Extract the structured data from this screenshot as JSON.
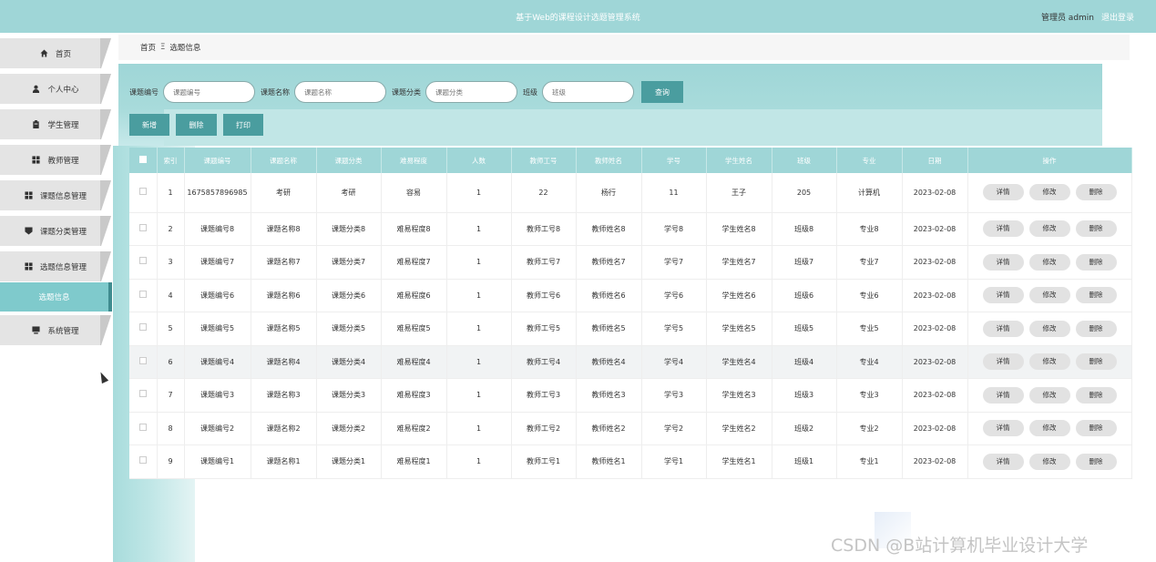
{
  "header": {
    "title": "基于Web的课程设计选题管理系统",
    "admin": "管理员 admin",
    "logout": "退出登录"
  },
  "sidebar": {
    "items": [
      {
        "label": "首页",
        "icon": "home-icon"
      },
      {
        "label": "个人中心",
        "icon": "user-icon"
      },
      {
        "label": "学生管理",
        "icon": "clipboard-icon"
      },
      {
        "label": "教师管理",
        "icon": "grid-icon"
      },
      {
        "label": "课题信息管理",
        "icon": "grid-icon"
      },
      {
        "label": "课题分类管理",
        "icon": "tag-icon"
      },
      {
        "label": "选题信息管理",
        "icon": "grid-icon"
      },
      {
        "label": "系统管理",
        "icon": "monitor-icon"
      }
    ],
    "active_sub": "选题信息"
  },
  "breadcrumb": {
    "home": "首页",
    "sep": "Ξ",
    "current": "选题信息"
  },
  "search": {
    "fields": [
      {
        "label": "课题编号",
        "placeholder": "课题编号"
      },
      {
        "label": "课题名称",
        "placeholder": "课题名称"
      },
      {
        "label": "课题分类",
        "placeholder": "课题分类"
      },
      {
        "label": "班级",
        "placeholder": "班级"
      }
    ],
    "query_btn": "查询"
  },
  "actions": {
    "add": "新增",
    "delete": "删除",
    "print": "打印"
  },
  "table": {
    "headers": [
      "索引",
      "课题编号",
      "课题名称",
      "课题分类",
      "难易程度",
      "人数",
      "教师工号",
      "教师姓名",
      "学号",
      "学生姓名",
      "班级",
      "专业",
      "日期",
      "操作"
    ],
    "ops": {
      "detail": "详情",
      "edit": "修改",
      "del": "删除"
    },
    "rows": [
      [
        "1",
        "1675857896985",
        "考研",
        "考研",
        "容易",
        "1",
        "22",
        "杨行",
        "11",
        "王子",
        "205",
        "计算机",
        "2023-02-08"
      ],
      [
        "2",
        "课题编号8",
        "课题名称8",
        "课题分类8",
        "难易程度8",
        "1",
        "教师工号8",
        "教师姓名8",
        "学号8",
        "学生姓名8",
        "班级8",
        "专业8",
        "2023-02-08"
      ],
      [
        "3",
        "课题编号7",
        "课题名称7",
        "课题分类7",
        "难易程度7",
        "1",
        "教师工号7",
        "教师姓名7",
        "学号7",
        "学生姓名7",
        "班级7",
        "专业7",
        "2023-02-08"
      ],
      [
        "4",
        "课题编号6",
        "课题名称6",
        "课题分类6",
        "难易程度6",
        "1",
        "教师工号6",
        "教师姓名6",
        "学号6",
        "学生姓名6",
        "班级6",
        "专业6",
        "2023-02-08"
      ],
      [
        "5",
        "课题编号5",
        "课题名称5",
        "课题分类5",
        "难易程度5",
        "1",
        "教师工号5",
        "教师姓名5",
        "学号5",
        "学生姓名5",
        "班级5",
        "专业5",
        "2023-02-08"
      ],
      [
        "6",
        "课题编号4",
        "课题名称4",
        "课题分类4",
        "难易程度4",
        "1",
        "教师工号4",
        "教师姓名4",
        "学号4",
        "学生姓名4",
        "班级4",
        "专业4",
        "2023-02-08"
      ],
      [
        "7",
        "课题编号3",
        "课题名称3",
        "课题分类3",
        "难易程度3",
        "1",
        "教师工号3",
        "教师姓名3",
        "学号3",
        "学生姓名3",
        "班级3",
        "专业3",
        "2023-02-08"
      ],
      [
        "8",
        "课题编号2",
        "课题名称2",
        "课题分类2",
        "难易程度2",
        "1",
        "教师工号2",
        "教师姓名2",
        "学号2",
        "学生姓名2",
        "班级2",
        "专业2",
        "2023-02-08"
      ],
      [
        "9",
        "课题编号1",
        "课题名称1",
        "课题分类1",
        "难易程度1",
        "1",
        "教师工号1",
        "教师姓名1",
        "学号1",
        "学生姓名1",
        "班级1",
        "专业1",
        "2023-02-08"
      ]
    ]
  },
  "watermark": "CSDN @B站计算机毕业设计大学",
  "colors": {
    "accent": "#9fd6d7",
    "button": "#4a9d9f",
    "active": "#7fcacc"
  }
}
